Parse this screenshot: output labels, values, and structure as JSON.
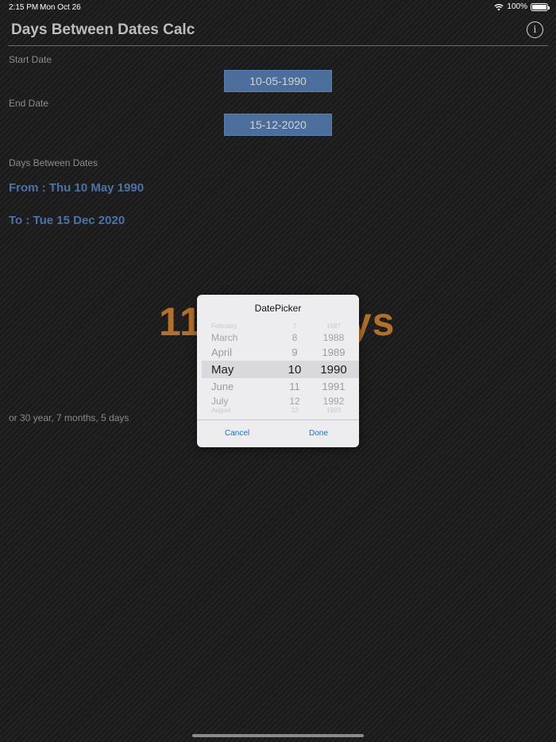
{
  "status_bar": {
    "time": "2:15 PM",
    "date": "Mon Oct 26",
    "battery": "100%"
  },
  "header": {
    "title": "Days Between Dates Calc"
  },
  "start": {
    "label": "Start Date",
    "value": "10-05-1990"
  },
  "end": {
    "label": "End Date",
    "value": "15-12-2020"
  },
  "result": {
    "label": "Days Between Dates",
    "from": "From : Thu 10 May 1990",
    "to": "To : Tue 15 Dec 2020",
    "days_partial_left": "11",
    "days_partial_right": "ys",
    "breakdown": "or 30 year, 7 months, 5 days"
  },
  "picker": {
    "title": "DatePicker",
    "months": [
      "February",
      "March",
      "April",
      "May",
      "June",
      "July",
      "August"
    ],
    "days": [
      "7",
      "8",
      "9",
      "10",
      "11",
      "12",
      "13"
    ],
    "years": [
      "1987",
      "1988",
      "1989",
      "1990",
      "1991",
      "1992",
      "1993"
    ],
    "cancel": "Cancel",
    "done": "Done"
  },
  "colors": {
    "accent": "#4a73a8",
    "result": "#b3702c",
    "button": "#4b6e9c",
    "picker_action": "#1a73d9"
  },
  "icons": {
    "info": "info-icon",
    "wifi": "wifi-icon",
    "battery": "battery-icon"
  }
}
